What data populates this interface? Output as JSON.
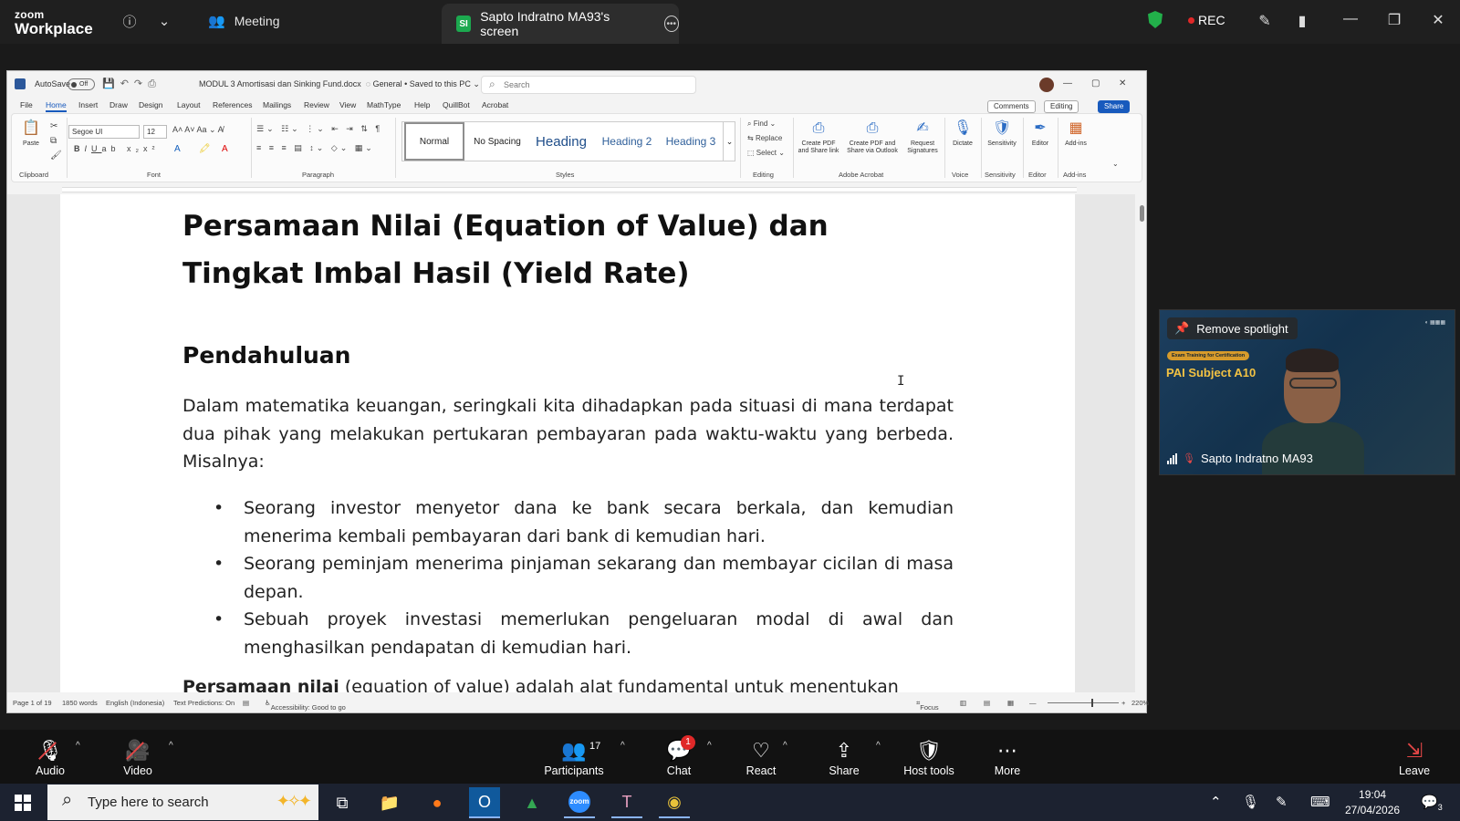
{
  "zoom": {
    "logo_line1": "zoom",
    "logo_line2": "Workplace",
    "meeting_label": "Meeting",
    "share_tab_initials": "SI",
    "share_tab_label": "Sapto Indratno MA93's screen",
    "rec_label": "REC",
    "toolbar": {
      "audio": "Audio",
      "video": "Video",
      "participants": "Participants",
      "participants_count": "17",
      "chat": "Chat",
      "chat_badge": "1",
      "react": "React",
      "share": "Share",
      "host_tools": "Host tools",
      "more": "More",
      "leave": "Leave"
    }
  },
  "word": {
    "autosave_label": "AutoSave",
    "autosave_state": "Off",
    "document_name": "MODUL 3 Amortisasi dan Sinking Fund.docx",
    "save_status": "General • Saved to this PC",
    "search_placeholder": "Search",
    "menu": [
      "File",
      "Home",
      "Insert",
      "Draw",
      "Design",
      "Layout",
      "References",
      "Mailings",
      "Review",
      "View",
      "MathType",
      "Help",
      "QuillBot",
      "Acrobat"
    ],
    "comments_btn": "Comments",
    "editing_btn": "Editing",
    "share_btn": "Share",
    "ribbon": {
      "paste": "Paste",
      "clipboard": "Clipboard",
      "font_name": "Segoe UI",
      "font_size": "12",
      "font": "Font",
      "paragraph": "Paragraph",
      "styles_label": "Styles",
      "styles": [
        "Normal",
        "No Spacing",
        "Heading",
        "Heading 2",
        "Heading 3"
      ],
      "find": "Find",
      "replace": "Replace",
      "select": "Select",
      "editing": "Editing",
      "create_pdf_1": "Create PDF",
      "create_pdf_2": "and Share link",
      "create_pdf_outlook_1": "Create PDF and",
      "create_pdf_outlook_2": "Share via Outlook",
      "request_1": "Request",
      "request_2": "Signatures",
      "adobe_acrobat": "Adobe Acrobat",
      "dictate": "Dictate",
      "voice": "Voice",
      "sensitivity": "Sensitivity",
      "editor": "Editor",
      "addins": "Add-ins"
    },
    "document": {
      "title": "Persamaan Nilai (Equation of Value) dan Tingkat Imbal Hasil (Yield Rate)",
      "heading": "Pendahuluan",
      "paragraph": "Dalam matematika keuangan, seringkali kita dihadapkan pada situasi di mana terdapat dua pihak yang melakukan pertukaran pembayaran pada waktu-waktu yang berbeda. Misalnya:",
      "bullets": [
        "Seorang investor menyetor dana ke bank secara berkala, dan kemudian menerima kembali pembayaran dari bank di kemudian hari.",
        "Seorang peminjam menerima pinjaman sekarang dan membayar cicilan di masa depan.",
        "Sebuah proyek investasi memerlukan pengeluaran modal di awal dan menghasilkan pendapatan di kemudian hari."
      ],
      "cut_bold": "Persamaan nilai",
      "cut_rest": " (equation of value) adalah alat fundamental untuk menentukan"
    },
    "status": {
      "page": "Page 1 of 19",
      "words": "1850 words",
      "language": "English (Indonesia)",
      "predictions": "Text Predictions: On",
      "accessibility": "Accessibility: Good to go",
      "focus": "Focus",
      "zoom": "220%"
    }
  },
  "video": {
    "remove_spotlight": "Remove spotlight",
    "badge": "Exam Training for Certification",
    "headline": "PAI Subject A10",
    "participant_name": "Sapto Indratno MA93"
  },
  "taskbar": {
    "search_placeholder": "Type here to search",
    "time": "19:04",
    "date": "27/04/2026",
    "notification_count": "3"
  }
}
